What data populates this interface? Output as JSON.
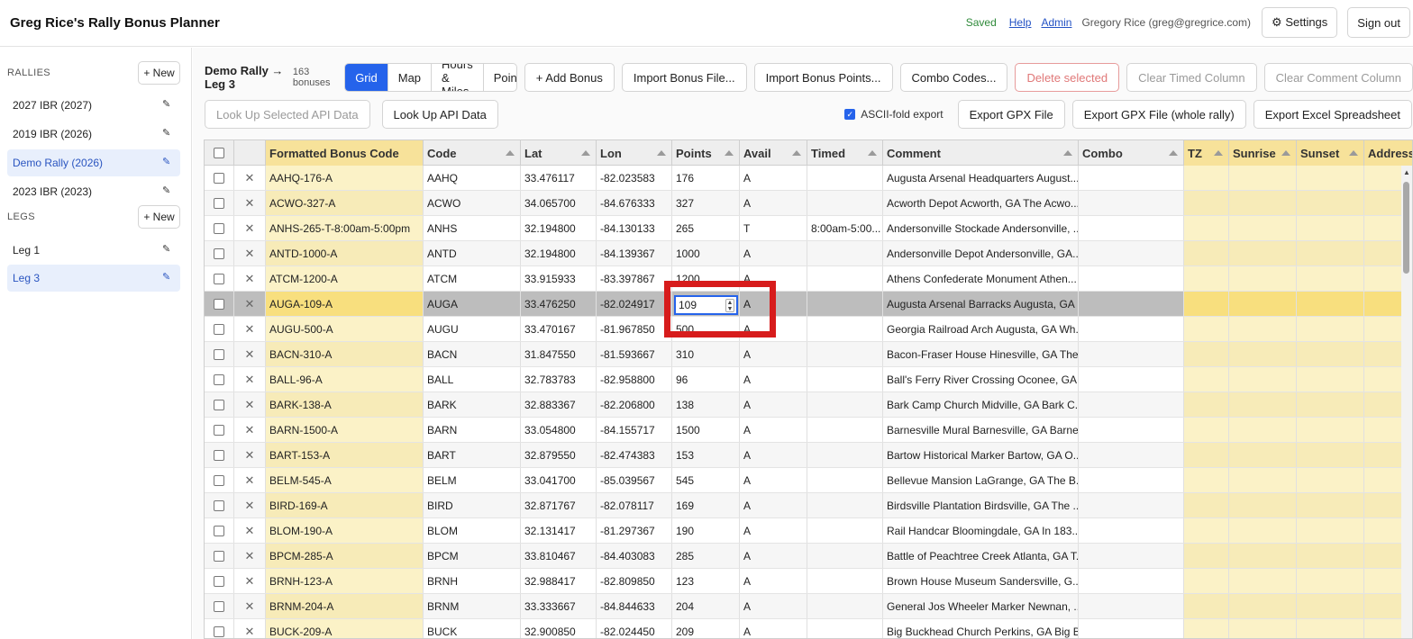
{
  "header": {
    "title": "Greg Rice's Rally Bonus Planner",
    "saved": "Saved",
    "help": "Help",
    "admin": "Admin",
    "user": "Gregory Rice (greg@gregrice.com)",
    "settings": "⚙ Settings",
    "signout": "Sign out"
  },
  "sidebar": {
    "rallies_title": "RALLIES",
    "legs_title": "LEGS",
    "new_label": "+ New",
    "rallies": [
      {
        "label": "2027 IBR (2027)"
      },
      {
        "label": "2019 IBR (2026)"
      },
      {
        "label": "Demo Rally (2026)"
      },
      {
        "label": "2023 IBR (2023)"
      }
    ],
    "legs": [
      {
        "label": "Leg 1"
      },
      {
        "label": "Leg 3"
      }
    ]
  },
  "toolbar": {
    "crumb": "Demo Rally → Leg 3",
    "count": "163 bonuses",
    "tabs": [
      "Grid",
      "Map",
      "Hours & Miles",
      "Points"
    ],
    "add_bonus": "+ Add Bonus",
    "import_file": "Import Bonus File...",
    "import_points": "Import Bonus Points...",
    "combo": "Combo Codes...",
    "delete": "Delete selected",
    "clear_timed": "Clear Timed Column",
    "clear_comment": "Clear Comment Column",
    "lookup_selected": "Look Up Selected API Data",
    "lookup": "Look Up API Data",
    "ascii": "ASCII-fold export",
    "export_gpx": "Export GPX File",
    "export_gpx_all": "Export GPX File (whole rally)",
    "export_excel": "Export Excel Spreadsheet"
  },
  "grid": {
    "columns": [
      "Formatted Bonus Code",
      "Code",
      "Lat",
      "Lon",
      "Points",
      "Avail",
      "Timed",
      "Comment",
      "Combo",
      "TZ",
      "Sunrise",
      "Sunset",
      "Address"
    ],
    "editing_value": "109",
    "rows": [
      {
        "fmt": "AAHQ-176-A",
        "code": "AAHQ",
        "lat": "33.476117",
        "lon": "-82.023583",
        "points": "176",
        "avail": "A",
        "timed": "",
        "comment": "Augusta Arsenal Headquarters August..."
      },
      {
        "fmt": "ACWO-327-A",
        "code": "ACWO",
        "lat": "34.065700",
        "lon": "-84.676333",
        "points": "327",
        "avail": "A",
        "timed": "",
        "comment": "Acworth Depot Acworth, GA The Acwo..."
      },
      {
        "fmt": "ANHS-265-T-8:00am-5:00pm",
        "code": "ANHS",
        "lat": "32.194800",
        "lon": "-84.130133",
        "points": "265",
        "avail": "T",
        "timed": "8:00am-5:00...",
        "comment": "Andersonville Stockade Andersonville, ..."
      },
      {
        "fmt": "ANTD-1000-A",
        "code": "ANTD",
        "lat": "32.194800",
        "lon": "-84.139367",
        "points": "1000",
        "avail": "A",
        "timed": "",
        "comment": "Andersonville Depot Andersonville, GA..."
      },
      {
        "fmt": "ATCM-1200-A",
        "code": "ATCM",
        "lat": "33.915933",
        "lon": "-83.397867",
        "points": "1200",
        "avail": "A",
        "timed": "",
        "comment": "Athens Confederate Monument Athen..."
      },
      {
        "fmt": "AUGA-109-A",
        "code": "AUGA",
        "lat": "33.476250",
        "lon": "-82.024917",
        "points": "109",
        "avail": "A",
        "timed": "",
        "comment": "Augusta Arsenal Barracks Augusta, GA ..."
      },
      {
        "fmt": "AUGU-500-A",
        "code": "AUGU",
        "lat": "33.470167",
        "lon": "-81.967850",
        "points": "500",
        "avail": "A",
        "timed": "",
        "comment": "Georgia Railroad Arch Augusta, GA Wh..."
      },
      {
        "fmt": "BACN-310-A",
        "code": "BACN",
        "lat": "31.847550",
        "lon": "-81.593667",
        "points": "310",
        "avail": "A",
        "timed": "",
        "comment": "Bacon-Fraser House Hinesville, GA The..."
      },
      {
        "fmt": "BALL-96-A",
        "code": "BALL",
        "lat": "32.783783",
        "lon": "-82.958800",
        "points": "96",
        "avail": "A",
        "timed": "",
        "comment": "Ball's Ferry River Crossing Oconee, GA ..."
      },
      {
        "fmt": "BARK-138-A",
        "code": "BARK",
        "lat": "32.883367",
        "lon": "-82.206800",
        "points": "138",
        "avail": "A",
        "timed": "",
        "comment": "Bark Camp Church Midville, GA Bark C..."
      },
      {
        "fmt": "BARN-1500-A",
        "code": "BARN",
        "lat": "33.054800",
        "lon": "-84.155717",
        "points": "1500",
        "avail": "A",
        "timed": "",
        "comment": "Barnesville Mural Barnesville, GA Barne..."
      },
      {
        "fmt": "BART-153-A",
        "code": "BART",
        "lat": "32.879550",
        "lon": "-82.474383",
        "points": "153",
        "avail": "A",
        "timed": "",
        "comment": "Bartow Historical Marker Bartow, GA O..."
      },
      {
        "fmt": "BELM-545-A",
        "code": "BELM",
        "lat": "33.041700",
        "lon": "-85.039567",
        "points": "545",
        "avail": "A",
        "timed": "",
        "comment": "Bellevue Mansion LaGrange, GA The B..."
      },
      {
        "fmt": "BIRD-169-A",
        "code": "BIRD",
        "lat": "32.871767",
        "lon": "-82.078117",
        "points": "169",
        "avail": "A",
        "timed": "",
        "comment": "Birdsville Plantation Birdsville, GA The ..."
      },
      {
        "fmt": "BLOM-190-A",
        "code": "BLOM",
        "lat": "32.131417",
        "lon": "-81.297367",
        "points": "190",
        "avail": "A",
        "timed": "",
        "comment": "Rail Handcar Bloomingdale, GA In 183..."
      },
      {
        "fmt": "BPCM-285-A",
        "code": "BPCM",
        "lat": "33.810467",
        "lon": "-84.403083",
        "points": "285",
        "avail": "A",
        "timed": "",
        "comment": "Battle of Peachtree Creek Atlanta, GA T..."
      },
      {
        "fmt": "BRNH-123-A",
        "code": "BRNH",
        "lat": "32.988417",
        "lon": "-82.809850",
        "points": "123",
        "avail": "A",
        "timed": "",
        "comment": "Brown House Museum Sandersville, G..."
      },
      {
        "fmt": "BRNM-204-A",
        "code": "BRNM",
        "lat": "33.333667",
        "lon": "-84.844633",
        "points": "204",
        "avail": "A",
        "timed": "",
        "comment": "General Jos Wheeler Marker Newnan, ..."
      },
      {
        "fmt": "BUCK-209-A",
        "code": "BUCK",
        "lat": "32.900850",
        "lon": "-82.024450",
        "points": "209",
        "avail": "A",
        "timed": "",
        "comment": "Big Buckhead Church Perkins, GA Big B..."
      }
    ]
  }
}
